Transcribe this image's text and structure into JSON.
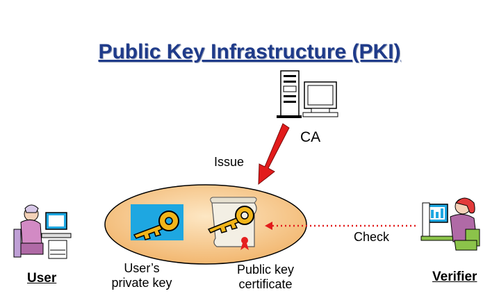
{
  "title": "Public Key Infrastructure (PKI)",
  "labels": {
    "ca": "CA",
    "issue": "Issue",
    "check": "Check",
    "user": "User",
    "verifier": "Verifier",
    "private_key_line1": "User’s",
    "private_key_line2": "private key",
    "public_cert_line1": "Public key",
    "public_cert_line2": "certificate"
  },
  "colors": {
    "title": "#1f3b8a",
    "issue_arrow": "#e21b1b",
    "check_arrow": "#e21b1b",
    "ellipse_fill": "#f6c98c",
    "key_tile": "#1ea7e1",
    "key_color": "#f2b51a"
  },
  "icons": [
    "server-computer-icon",
    "user-at-computer-icon",
    "verifier-at-computer-icon",
    "private-key-icon",
    "certificate-key-icon"
  ]
}
